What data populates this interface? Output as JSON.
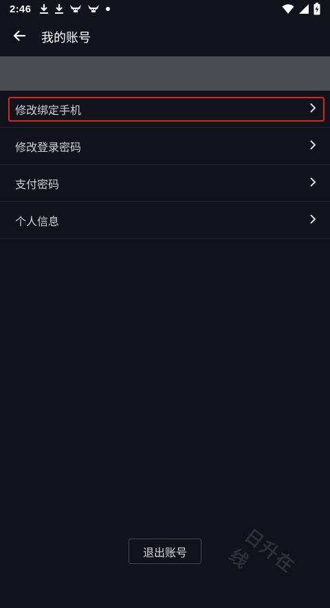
{
  "status_bar": {
    "time": "2:46",
    "icons_left": [
      "download-icon",
      "download-icon",
      "bull-icon",
      "bull-icon",
      "dot-icon"
    ],
    "icons_right": [
      "wifi-icon",
      "signal-icon",
      "battery-charging-icon"
    ]
  },
  "header": {
    "back_icon": "arrow-left-icon",
    "title": "我的账号"
  },
  "menu": {
    "items": [
      {
        "label": "修改绑定手机",
        "icon": "chevron-right-icon",
        "highlighted": true
      },
      {
        "label": "修改登录密码",
        "icon": "chevron-right-icon"
      },
      {
        "label": "支付密码",
        "icon": "chevron-right-icon"
      },
      {
        "label": "个人信息",
        "icon": "chevron-right-icon"
      }
    ]
  },
  "logout_button": {
    "label": "退出账号"
  },
  "watermark": {
    "text": "日升在线"
  },
  "colors": {
    "background": "#10131b",
    "banner": "#4a4c53",
    "highlight_border": "#e0211f",
    "divider": "#232630"
  }
}
